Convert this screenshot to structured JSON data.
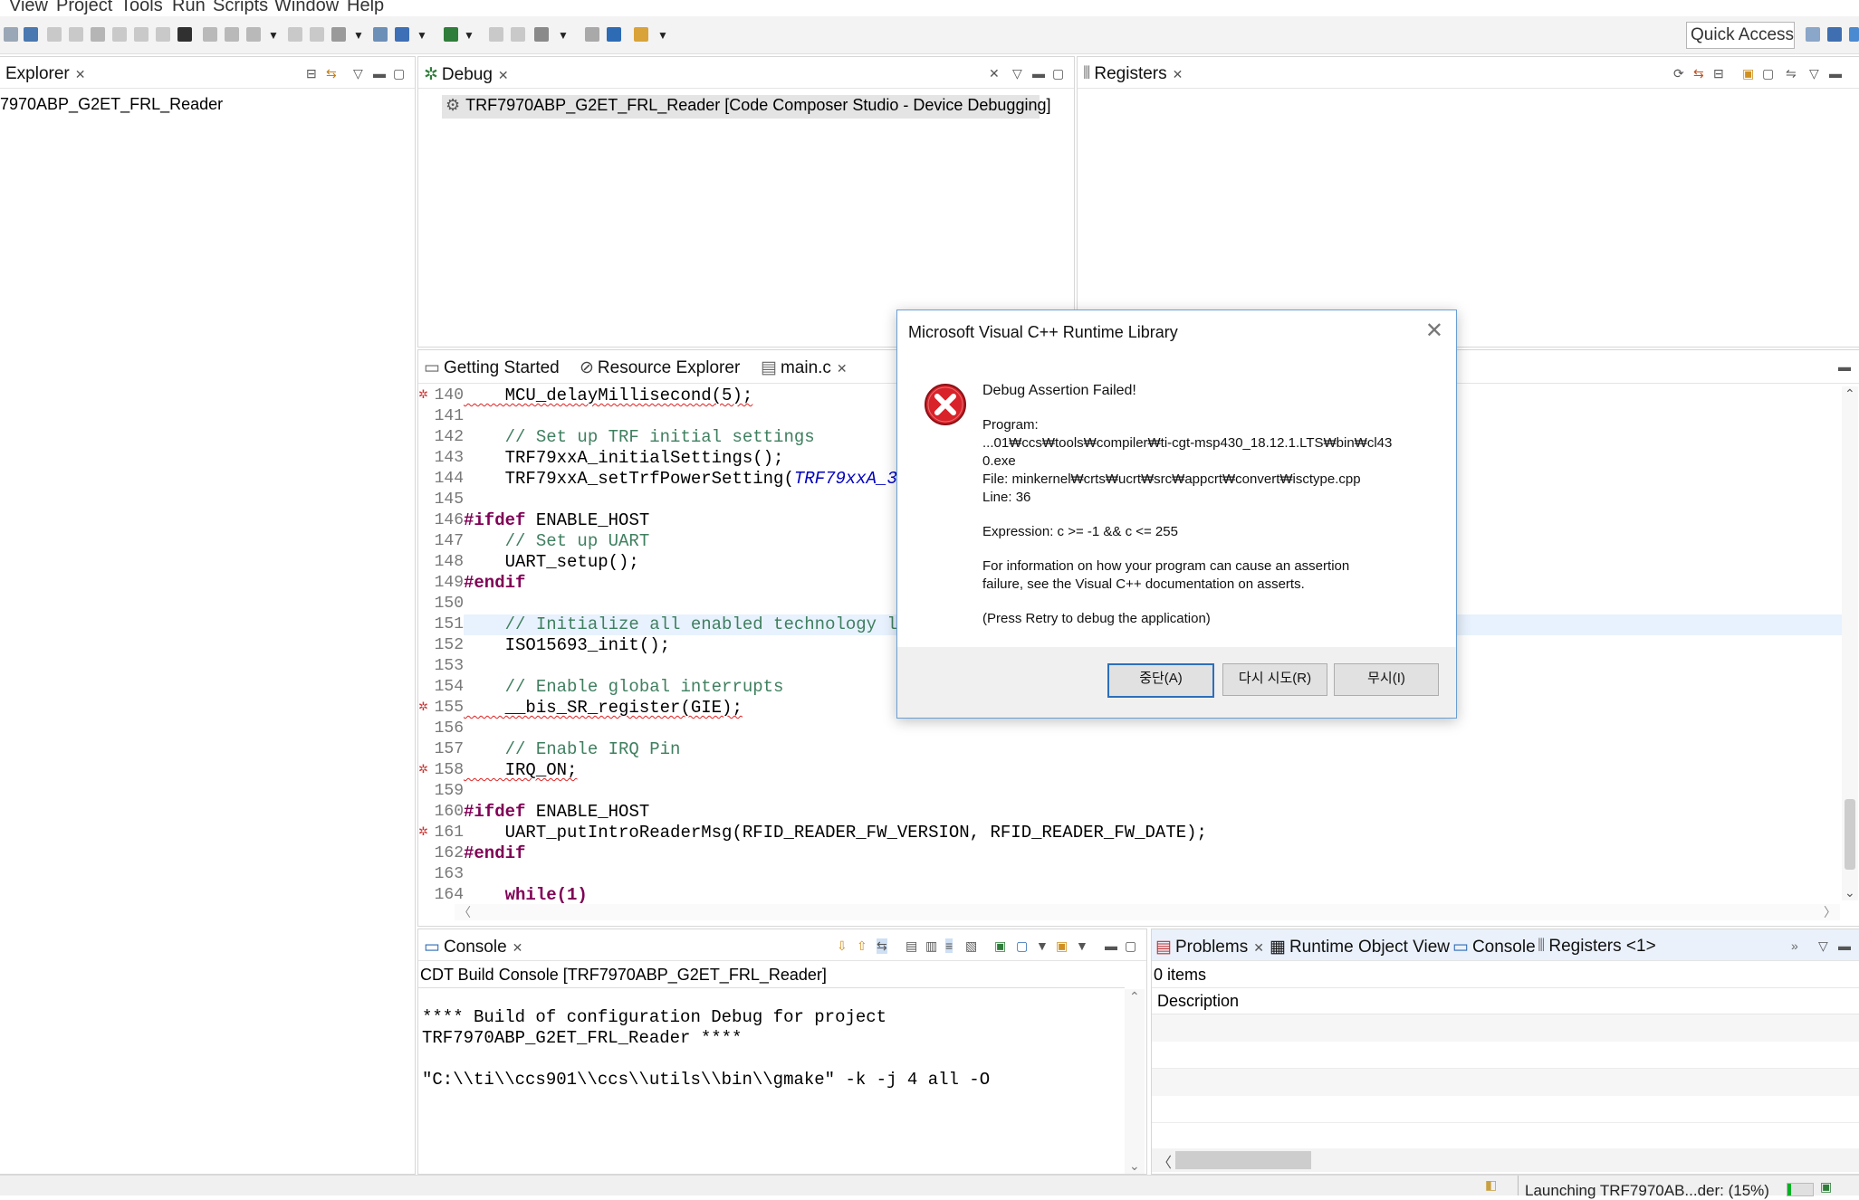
{
  "menu": [
    "View",
    "Project",
    "Tools",
    "Run",
    "Scripts",
    "Window",
    "Help"
  ],
  "toolbar": {
    "quick_access": "Quick Access"
  },
  "explorer": {
    "tab": "Explorer",
    "item": "7970ABP_G2ET_FRL_Reader"
  },
  "debug": {
    "tab": "Debug",
    "session": "TRF7970ABP_G2ET_FRL_Reader [Code Composer Studio - Device Debugging]"
  },
  "registers": {
    "tab": "Registers"
  },
  "editor": {
    "tabs": [
      "Getting Started",
      "Resource Explorer",
      "main.c"
    ],
    "lines": [
      {
        "n": "140",
        "text": "    MCU_delayMillisecond(5);"
      },
      {
        "n": "141",
        "text": ""
      },
      {
        "n": "142",
        "text": "    // Set up TRF initial settings"
      },
      {
        "n": "143",
        "text": "    TRF79xxA_initialSettings();"
      },
      {
        "n": "144",
        "text": "    TRF79xxA_setTrfPowerSetting(TRF79xxA_3V_"
      },
      {
        "n": "145",
        "text": ""
      },
      {
        "n": "146",
        "text": "#ifdef ENABLE_HOST"
      },
      {
        "n": "147",
        "text": "    // Set up UART"
      },
      {
        "n": "148",
        "text": "    UART_setup();"
      },
      {
        "n": "149",
        "text": "#endif"
      },
      {
        "n": "150",
        "text": ""
      },
      {
        "n": "151",
        "text": "    // Initialize all enabled technology lay"
      },
      {
        "n": "152",
        "text": "    ISO15693_init();"
      },
      {
        "n": "153",
        "text": ""
      },
      {
        "n": "154",
        "text": "    // Enable global interrupts"
      },
      {
        "n": "155",
        "text": "    __bis_SR_register(GIE);"
      },
      {
        "n": "156",
        "text": ""
      },
      {
        "n": "157",
        "text": "    // Enable IRQ Pin"
      },
      {
        "n": "158",
        "text": "    IRQ_ON;"
      },
      {
        "n": "159",
        "text": ""
      },
      {
        "n": "160",
        "text": "#ifdef ENABLE_HOST"
      },
      {
        "n": "161",
        "text": "    UART_putIntroReaderMsg(RFID_READER_FW_VERSION, RFID_READER_FW_DATE);"
      },
      {
        "n": "162",
        "text": "#endif"
      },
      {
        "n": "163",
        "text": ""
      },
      {
        "n": "164",
        "text": "    while(1)"
      }
    ]
  },
  "console": {
    "tab": "Console",
    "header": "CDT Build Console [TRF7970ABP_G2ET_FRL_Reader]",
    "lines": [
      "**** Build of configuration Debug for project",
      "TRF7970ABP_G2ET_FRL_Reader ****",
      "",
      "\"C:\\\\ti\\\\ccs901\\\\ccs\\\\utils\\\\bin\\\\gmake\" -k -j 4 all -O"
    ]
  },
  "problems": {
    "tabs": [
      "Problems",
      "Runtime Object View",
      "Console",
      "Registers <1>"
    ],
    "count": "0 items",
    "column": "Description"
  },
  "dialog": {
    "title": "Microsoft Visual C++ Runtime Library",
    "heading": "Debug Assertion Failed!",
    "program_label": "Program:",
    "program_path_1": "...01₩ccs₩tools₩compiler₩ti-cgt-msp430_18.12.1.LTS₩bin₩cl43",
    "program_path_2": "0.exe",
    "file": "File: minkernel₩crts₩ucrt₩src₩appcrt₩convert₩isctype.cpp",
    "line": "Line: 36",
    "expression": "Expression: c >= -1 && c <= 255",
    "info_1": "For information on how your program can cause an assertion",
    "info_2": "failure, see the Visual C++ documentation on asserts.",
    "press": "(Press Retry to debug the application)",
    "buttons": {
      "abort": "중단(A)",
      "retry": "다시 시도(R)",
      "ignore": "무시(I)"
    }
  },
  "status": {
    "text": "Launching TRF7970AB...der: (15%)",
    "progress": 0.15
  }
}
